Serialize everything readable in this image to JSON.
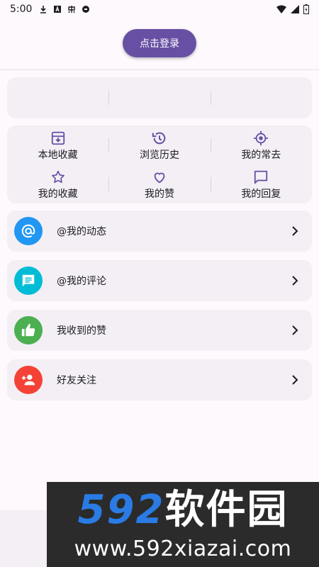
{
  "status_bar": {
    "time": "5:00",
    "left_icons": [
      "download-icon",
      "a-box-icon",
      "app-icon",
      "circle-icon"
    ],
    "right_icons": [
      "wifi-icon",
      "signal-icon",
      "battery-icon"
    ]
  },
  "login": {
    "label": "点击登录"
  },
  "stats": {
    "cells": [
      "",
      "",
      ""
    ]
  },
  "quick_grid": {
    "row1": [
      {
        "label": "本地收藏",
        "icon": "archive-icon"
      },
      {
        "label": "浏览历史",
        "icon": "history-icon"
      },
      {
        "label": "我的常去",
        "icon": "location-icon"
      }
    ],
    "row2": [
      {
        "label": "我的收藏",
        "icon": "star-icon"
      },
      {
        "label": "我的赞",
        "icon": "heart-icon"
      },
      {
        "label": "我的回复",
        "icon": "comment-icon"
      }
    ]
  },
  "menu": [
    {
      "label": "@我的动态",
      "icon": "at-icon",
      "color": "#2196f3"
    },
    {
      "label": "@我的评论",
      "icon": "message-icon",
      "color": "#00bcd4"
    },
    {
      "label": "我收到的赞",
      "icon": "thumb-up-icon",
      "color": "#4caf50"
    },
    {
      "label": "好友关注",
      "icon": "person-add-icon",
      "color": "#f44336"
    }
  ],
  "colors": {
    "primary": "#6750a4",
    "card": "#f3eff5",
    "background": "#fdf9fd"
  },
  "watermark": {
    "brand_num": "592",
    "brand_cn": "软件园",
    "url": "www.592xiazai.com"
  }
}
